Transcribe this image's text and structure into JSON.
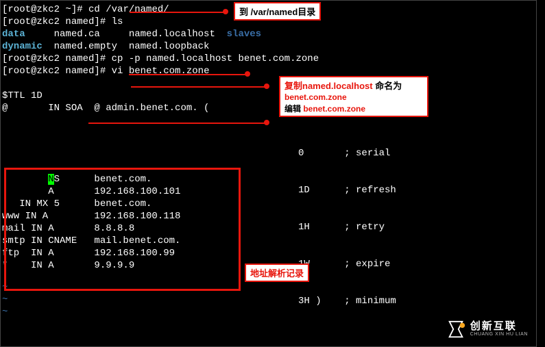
{
  "terminal": {
    "lines": {
      "l1_prompt": "[root@zkc2 ~]# ",
      "l1_cmd": "cd /var/named/",
      "l2_prompt": "[root@zkc2 named]# ",
      "l2_cmd": "ls",
      "l3_data": "data",
      "l3_rest1": "     named.ca     named.localhost  ",
      "l3_slaves": "slaves",
      "l4_dynamic": "dynamic",
      "l4_rest": "  named.empty  named.loopback",
      "l5_prompt": "[root@zkc2 named]# ",
      "l5_cmd": "cp -p named.localhost benet.com.zone",
      "l6_prompt": "[root@zkc2 named]# ",
      "l6_cmd": "vi benet.com.zone",
      "l7": "$TTL 1D",
      "l8": "@       IN SOA  @ admin.benet.com. (",
      "soa1": "0       ; serial",
      "soa2": "1D      ; refresh",
      "soa3": "1H      ; retry",
      "soa4": "1W      ; expire",
      "soa5": "3H )    ; minimum",
      "r1_cursor": "N",
      "r1": "S      benet.com.",
      "r2": "        A       192.168.100.101",
      "r3": "   IN MX 5      benet.com.",
      "r4": "www IN A        192.168.100.118",
      "r5": "mail IN A       8.8.8.8",
      "r6": "smtp IN CNAME   mail.benet.com.",
      "r7": "ftp  IN A       192.168.100.99",
      "r8": "*    IN A       9.9.9.9",
      "tilde": "~"
    }
  },
  "annotations": {
    "a1": "到 /var/named目录",
    "a2_l1_red": "复制named.localhost ",
    "a2_l1_black": "命名为",
    "a2_l2": "benet.com.zone",
    "a2_l3_black": "编辑 ",
    "a2_l3_red": "benet.com.zone",
    "a3": "地址解析记录"
  },
  "logo": {
    "cn": "创新互联",
    "en": "CHUANG XIN HU LIAN"
  },
  "colors": {
    "red": "#e8160d",
    "blue": "#3a6fa8",
    "cyan": "#5cb3d6",
    "green": "#00ff00"
  }
}
